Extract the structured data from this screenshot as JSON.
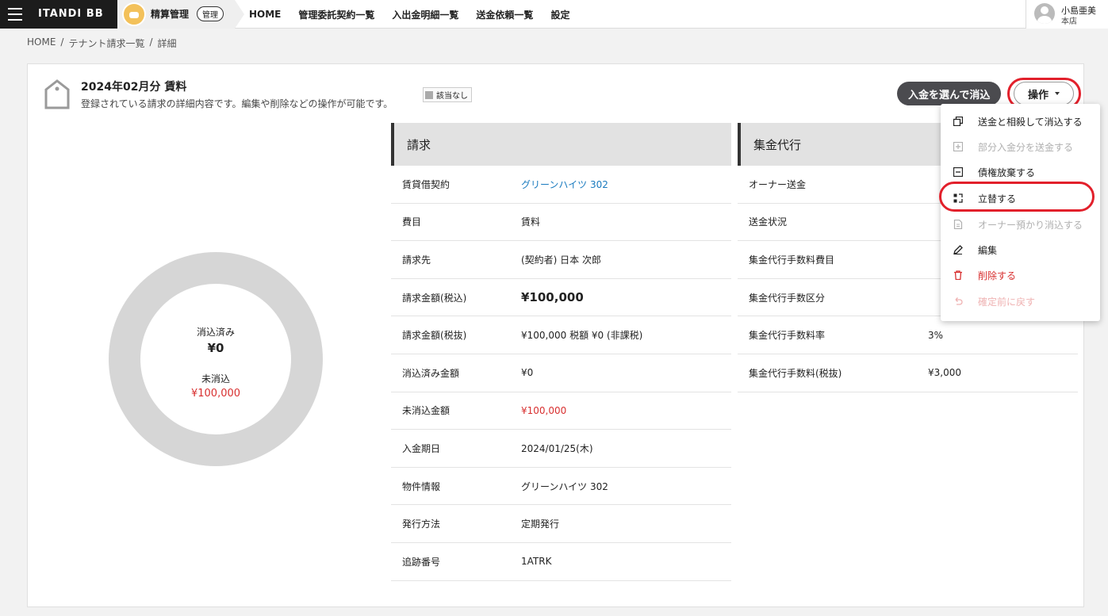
{
  "header": {
    "brand": "ITANDI BB",
    "app_name": "精算管理",
    "app_role": "管理",
    "nav": [
      "HOME",
      "管理委託契約一覧",
      "入出金明細一覧",
      "送金依頼一覧",
      "設定"
    ],
    "user_name": "小島亜美",
    "user_store": "本店"
  },
  "breadcrumb": [
    "HOME",
    "/",
    "テナント請求一覧",
    "/",
    "詳細"
  ],
  "page": {
    "title": "2024年02月分 賃料",
    "subtitle": "登録されている請求の詳細内容です。編集や削除などの操作が可能です。",
    "badge": "該当なし",
    "reconcile_button": "入金を選んで消込",
    "ops_button": "操作"
  },
  "donut": {
    "reconciled_label": "消込済み",
    "reconciled_value": "¥0",
    "unreconciled_label": "未消込",
    "unreconciled_value": "¥100,000"
  },
  "billing": {
    "heading": "請求",
    "rows": [
      {
        "k": "賃貸借契約",
        "v": "グリーンハイツ 302"
      },
      {
        "k": "費目",
        "v": "賃料"
      },
      {
        "k": "請求先",
        "v": "(契約者) 日本 次郎"
      },
      {
        "k": "請求金額(税込)",
        "v": "¥100,000"
      },
      {
        "k": "請求金額(税抜)",
        "v": "¥100,000  税額 ¥0 (非課税)"
      },
      {
        "k": "消込済み金額",
        "v": "¥0"
      },
      {
        "k": "未消込金額",
        "v": "¥100,000"
      },
      {
        "k": "入金期日",
        "v": "2024/01/25(木)"
      },
      {
        "k": "物件情報",
        "v": "グリーンハイツ 302"
      },
      {
        "k": "発行方法",
        "v": "定期発行"
      },
      {
        "k": "追跡番号",
        "v": "1ATRK"
      }
    ]
  },
  "collection": {
    "heading": "集金代行",
    "rows": [
      {
        "k": "オーナー送金",
        "v": ""
      },
      {
        "k": "送金状況",
        "v": ""
      },
      {
        "k": "集金代行手数料費目",
        "v": ""
      },
      {
        "k": "集金代行手数区分",
        "v": ""
      },
      {
        "k": "集金代行手数料率",
        "v": "3%"
      },
      {
        "k": "集金代行手数料(税抜)",
        "v": "¥3,000"
      }
    ]
  },
  "menu": [
    {
      "label": "送金と相殺して消込する",
      "icon": "copy-icon"
    },
    {
      "label": "部分入金分を送金する",
      "icon": "plus-square-icon"
    },
    {
      "label": "債権放棄する",
      "icon": "minus-square-icon"
    },
    {
      "label": "立替する",
      "icon": "advance-icon"
    },
    {
      "label": "オーナー預かり消込する",
      "icon": "document-icon"
    },
    {
      "label": "編集",
      "icon": "pencil-icon"
    },
    {
      "label": "削除する",
      "icon": "trash-icon"
    },
    {
      "label": "確定前に戻す",
      "icon": "undo-icon"
    }
  ],
  "colors": {
    "accent_red": "#d83030",
    "link_blue": "#1a7bbf",
    "highlight_red": "#e2202b",
    "dark_button": "#4b4b4f"
  }
}
